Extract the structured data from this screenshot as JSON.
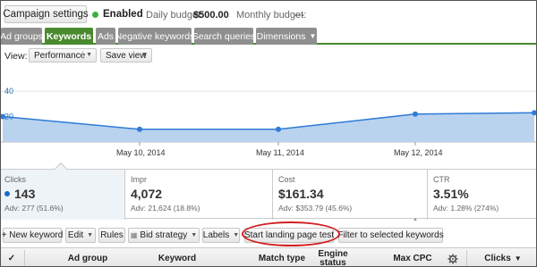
{
  "topbar": {
    "campaign_settings": "Campaign settings",
    "status": "Enabled",
    "daily_budget_label": "Daily budget:",
    "daily_budget_value": "$500.00",
    "monthly_budget_label": "Monthly budget:",
    "monthly_budget_value": "---"
  },
  "tabs": [
    {
      "label": "Ad groups",
      "active": false
    },
    {
      "label": "Keywords",
      "active": true
    },
    {
      "label": "Ads",
      "active": false
    },
    {
      "label": "Negative keywords",
      "active": false
    },
    {
      "label": "Search queries",
      "active": false
    },
    {
      "label": "Dimensions",
      "active": false,
      "dropdown": true
    }
  ],
  "viewbar": {
    "label": "View:",
    "view_select": "Performance",
    "save_view": "Save view"
  },
  "chart_data": {
    "type": "area",
    "y_ticks": [
      "40",
      "20"
    ],
    "ylim": [
      0,
      52
    ],
    "x": [
      0,
      1,
      2,
      3,
      4
    ],
    "x_tick_labels": [
      "May 10, 2014",
      "May 11, 2014",
      "May 12, 2014"
    ],
    "series": [
      {
        "values": [
          20,
          10,
          10,
          22,
          23
        ],
        "color": "#2f7bd6",
        "fill": "#b9d3ef"
      }
    ]
  },
  "metrics": [
    {
      "label": "Clicks",
      "value": "143",
      "adv": "Adv: 277 (51.6%)",
      "highlight": true
    },
    {
      "label": "Impr",
      "value": "4,072",
      "adv": "Adv: 21,624 (18.8%)"
    },
    {
      "label": "Cost",
      "value": "$161.34",
      "adv": "Adv: $353.79 (45.6%)"
    },
    {
      "label": "CTR",
      "value": "3.51%",
      "adv": "Adv: 1.28% (274%)"
    }
  ],
  "actions": {
    "new_keyword": "+ New keyword",
    "edit": "Edit",
    "rules": "Rules",
    "bid_strategy": "Bid strategy",
    "labels": "Labels",
    "start_landing_page_test": "Start landing page test",
    "filter_selected": "Filter to selected keywords"
  },
  "table_header": {
    "check": "✓",
    "ad_group": "Ad group",
    "keyword": "Keyword",
    "match_type": "Match type",
    "engine_status": "Engine status",
    "max_cpc": "Max CPC",
    "clicks": "Clicks",
    "gear_icon": "gear-icon"
  }
}
